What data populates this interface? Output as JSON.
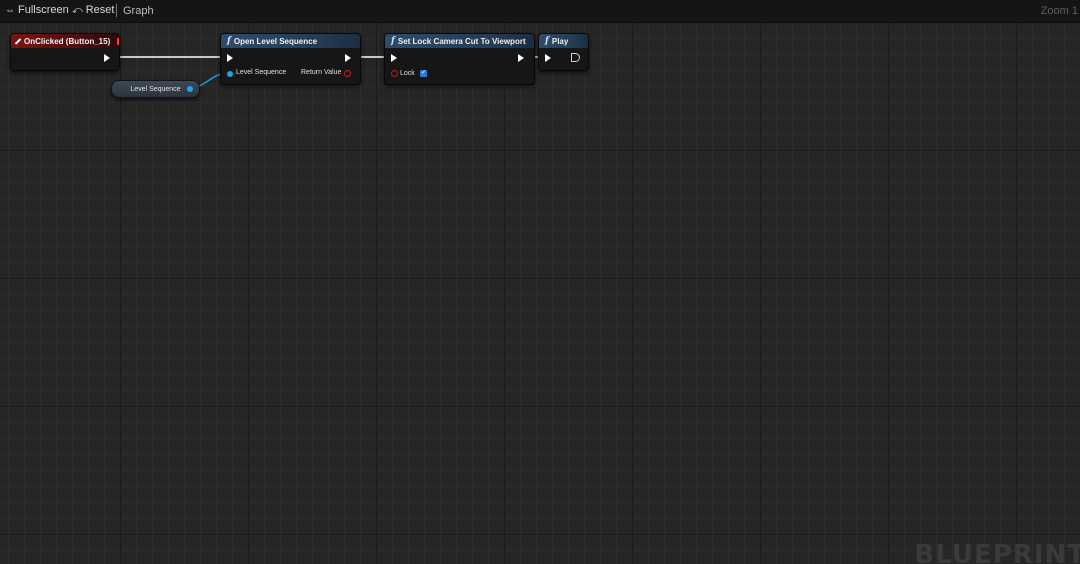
{
  "toolbar": {
    "fullscreen_label": "Fullscreen",
    "reset_label": "Reset",
    "graph_label": "Graph",
    "zoom_label": "Zoom 1"
  },
  "nodes": {
    "on_clicked": {
      "title": "OnClicked (Button_15)"
    },
    "open_level_sequence": {
      "title": "Open Level Sequence",
      "input_pin": "Level Sequence",
      "output_pin": "Return Value"
    },
    "set_lock_camera": {
      "title": "Set Lock Camera Cut To Viewport",
      "input_pin": "Lock",
      "lock_checked": true
    },
    "play": {
      "title": "Play"
    },
    "level_sequence_var": {
      "label": "Level Sequence"
    }
  },
  "watermark": "BLUEPRINT",
  "colors": {
    "event_header": "#7a1414",
    "function_header": "#2d4b6a",
    "object_pin": "#1ea3ea",
    "bool_pin": "#c41e1e",
    "exec_wire": "#ffffff"
  }
}
